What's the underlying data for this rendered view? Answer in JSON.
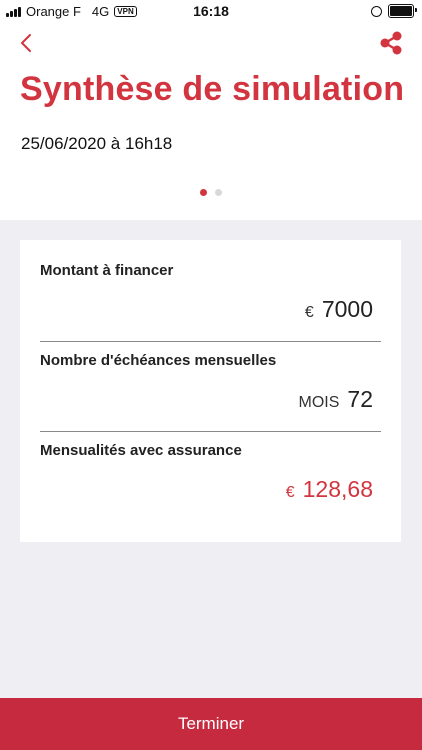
{
  "status_bar": {
    "carrier": "Orange F",
    "network": "4G",
    "vpn": "VPN",
    "time": "16:18",
    "battery_level": 1.0
  },
  "nav": {
    "back_icon": "chevron-left-icon",
    "share_icon": "share-icon"
  },
  "header": {
    "title": "Synthèse de simulation",
    "date": "25/06/2020 à 16h18"
  },
  "pager": {
    "count": 2,
    "active_index": 0
  },
  "summary": {
    "amount": {
      "label": "Montant à financer",
      "unit": "€",
      "value": "7000"
    },
    "installments": {
      "label": "Nombre d'échéances mensuelles",
      "unit": "MOIS",
      "value": "72"
    },
    "monthly": {
      "label": "Mensualités avec assurance",
      "unit": "€",
      "value": "128,68"
    }
  },
  "footer": {
    "button_label": "Terminer"
  },
  "colors": {
    "accent": "#d2353f",
    "button": "#c62a3e",
    "background": "#efeef3"
  }
}
